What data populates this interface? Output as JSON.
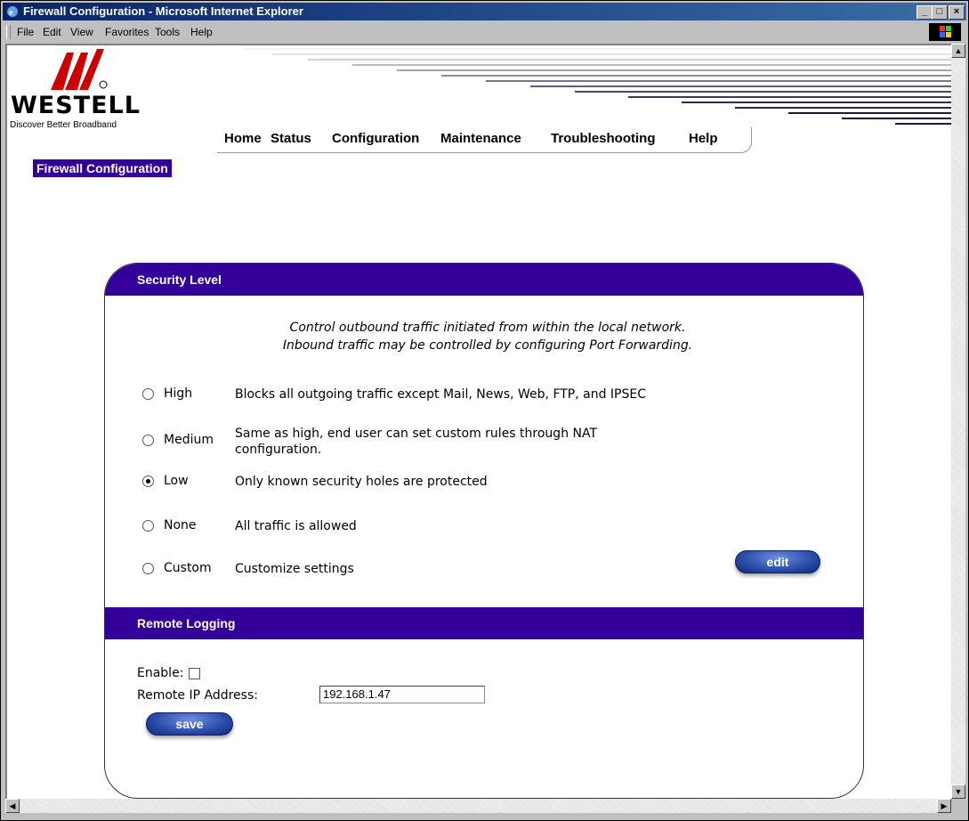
{
  "window": {
    "title": "Firewall Configuration - Microsoft Internet Explorer"
  },
  "menu": {
    "file": "File",
    "edit": "Edit",
    "view": "View",
    "favorites": "Favorites",
    "tools": "Tools",
    "help": "Help"
  },
  "brand": {
    "name": "WESTELL",
    "tagline": "Discover  Better Broadband"
  },
  "nav": {
    "home": "Home",
    "status": "Status",
    "configuration": "Configuration",
    "maintenance": "Maintenance",
    "troubleshooting": "Troubleshooting",
    "help": "Help"
  },
  "page": {
    "title": "Firewall Configuration"
  },
  "security": {
    "heading": "Security Level",
    "intro_line1": "Control outbound traffic initiated from within the local network.",
    "intro_line2": "Inbound traffic may be controlled by configuring Port Forwarding.",
    "options": [
      {
        "label": "High",
        "desc": "Blocks all outgoing traffic except Mail, News, Web, FTP, and IPSEC",
        "selected": false
      },
      {
        "label": "Medium",
        "desc": "Same as high, end user can set custom rules through NAT configuration.",
        "selected": false
      },
      {
        "label": "Low",
        "desc": "Only known security holes are protected",
        "selected": true
      },
      {
        "label": "None",
        "desc": "All traffic is allowed",
        "selected": false
      },
      {
        "label": "Custom",
        "desc": "Customize settings",
        "selected": false
      }
    ],
    "edit_label": "edit"
  },
  "remote_logging": {
    "heading": "Remote Logging",
    "enable_label": "Enable:",
    "enabled": false,
    "ip_label": "Remote IP Address:",
    "ip_value": "192.168.1.47",
    "save_label": "save"
  },
  "colors": {
    "accent": "#330099",
    "button": "#2a4aa8",
    "titlebar": "#0a246a"
  }
}
